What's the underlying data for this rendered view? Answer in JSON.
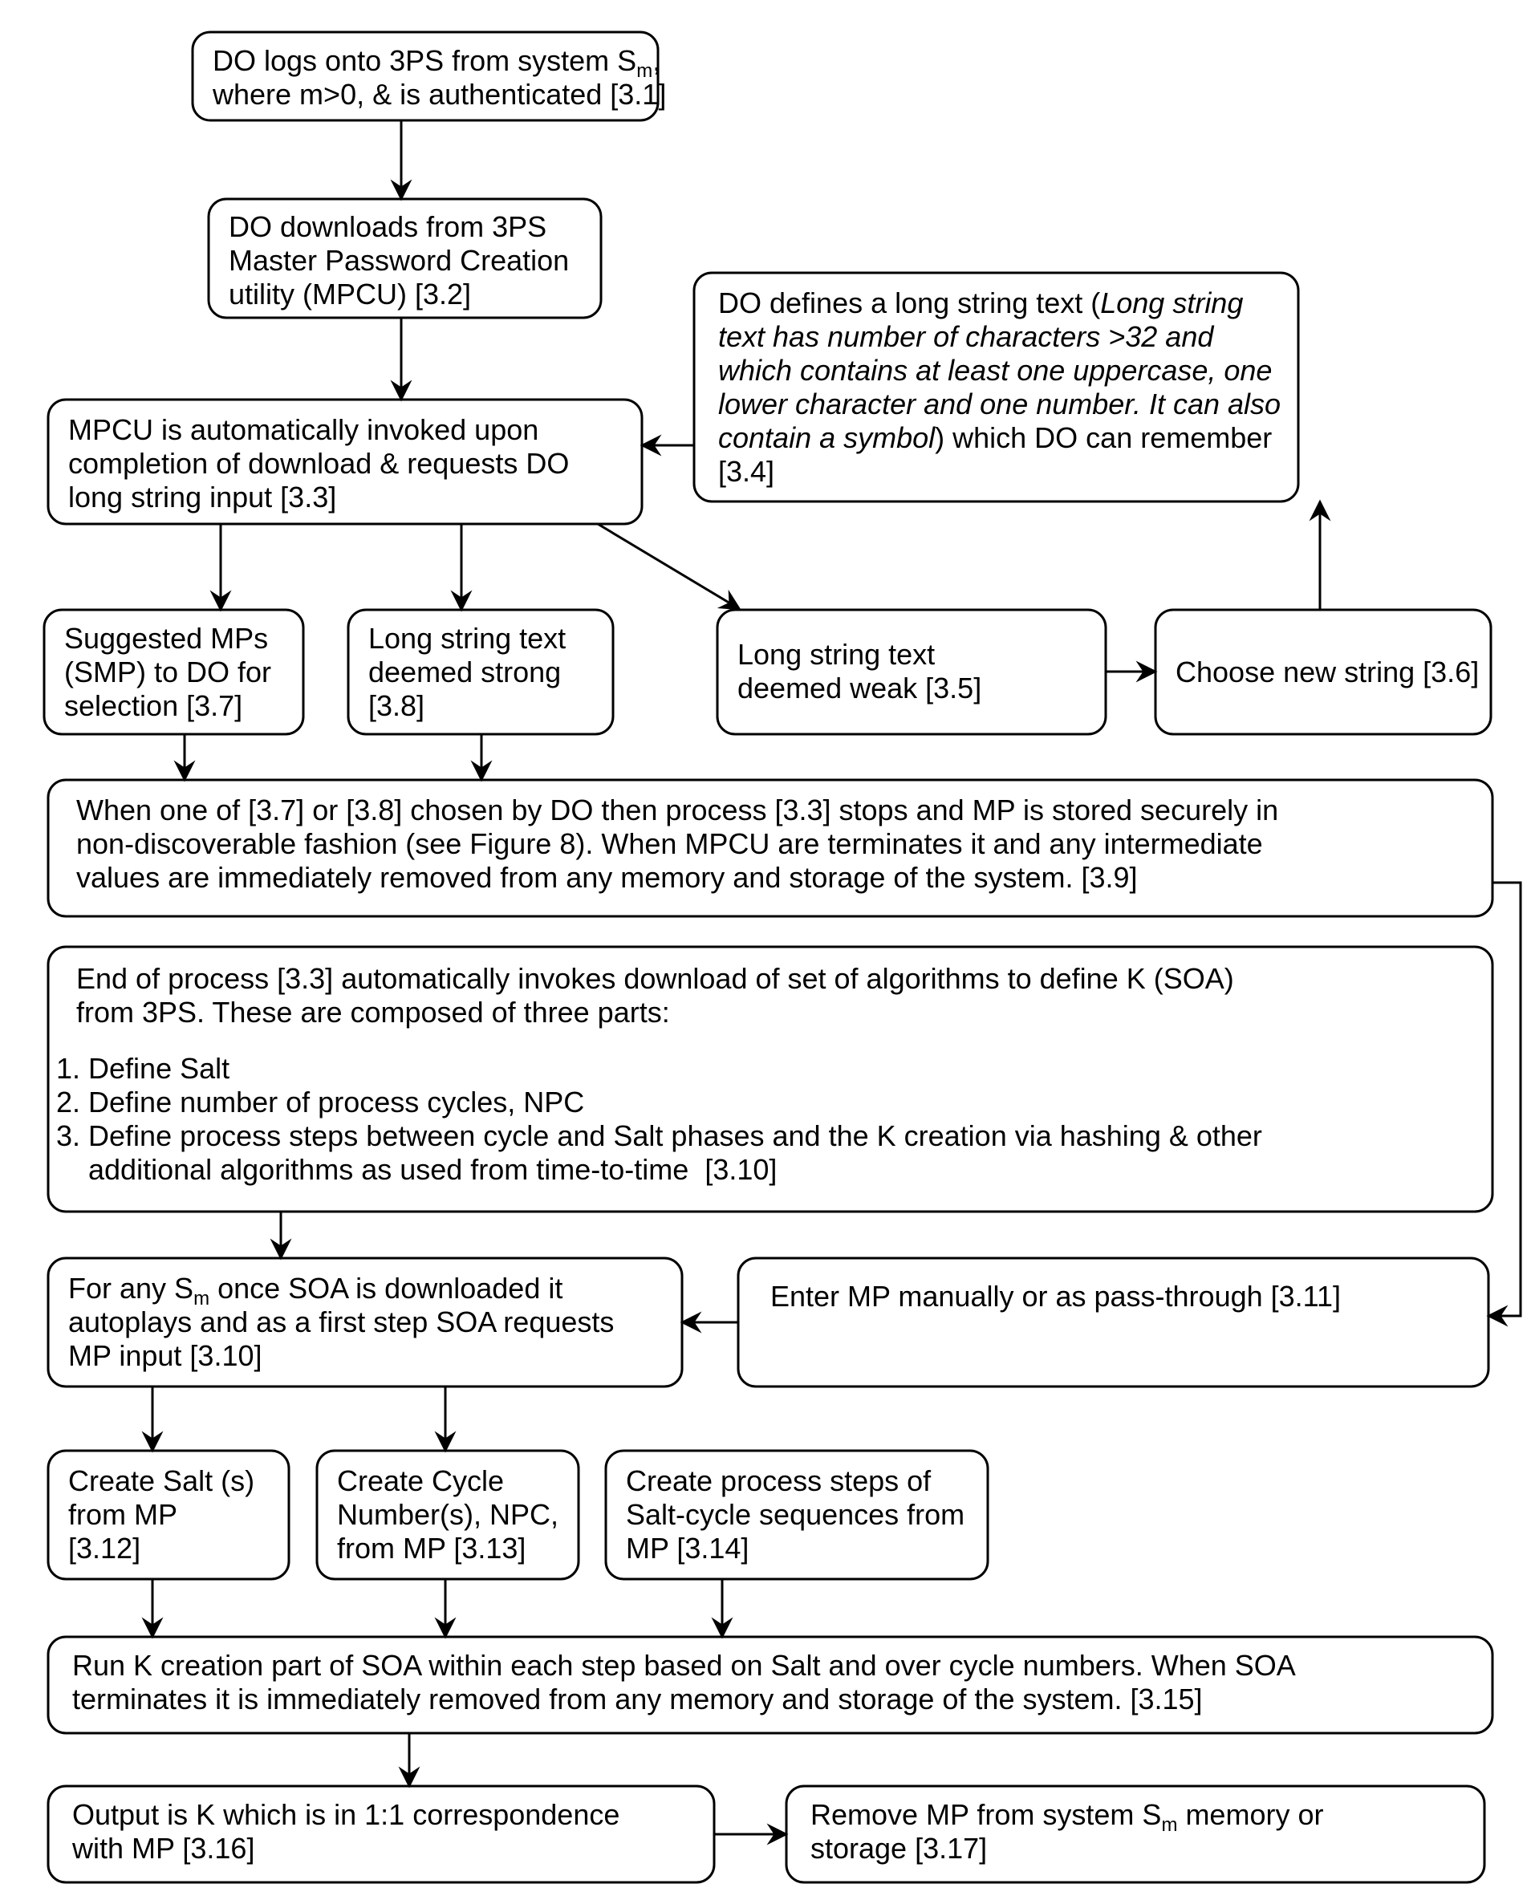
{
  "chart_data": {
    "type": "flowchart",
    "nodes": [
      {
        "id": "3.1",
        "lines": [
          "DO logs onto 3PS from system S_m,",
          "where m>0, & is authenticated [3.1]"
        ]
      },
      {
        "id": "3.2",
        "lines": [
          "DO downloads from 3PS",
          "Master Password Creation",
          "utility (MPCU) [3.2]"
        ]
      },
      {
        "id": "3.3",
        "lines": [
          "MPCU is automatically invoked upon",
          "completion of download & requests DO",
          "long string input [3.3]"
        ]
      },
      {
        "id": "3.4",
        "lines": [
          "DO defines a long string text (Long string",
          "text has number of characters >32 and",
          "which contains at least one uppercase, one",
          "lower character and one number. It can also",
          "contain a symbol) which DO can remember",
          "[3.4]"
        ]
      },
      {
        "id": "3.7",
        "lines": [
          "Suggested MPs",
          "(SMP) to DO for",
          "selection [3.7]"
        ]
      },
      {
        "id": "3.8",
        "lines": [
          "Long string text",
          "deemed strong",
          "[3.8]"
        ]
      },
      {
        "id": "3.5",
        "lines": [
          "Long string text",
          "deemed weak [3.5]"
        ]
      },
      {
        "id": "3.6",
        "lines": [
          "Choose new string [3.6]"
        ]
      },
      {
        "id": "3.9",
        "lines": [
          "When one of [3.7] or [3.8] chosen by DO then process [3.3] stops and MP is stored securely in",
          "non-discoverable fashion (see Figure 8). When MPCU are terminates it and any intermediate",
          "values are immediately removed from any memory and storage of the system. [3.9]"
        ]
      },
      {
        "id": "3.10a",
        "lines": [
          "End of process [3.3] automatically invokes download of set of algorithms to define K (SOA)",
          "from 3PS. These are composed of three parts:",
          "1. Define Salt",
          "2. Define number of process cycles, NPC",
          "3. Define process steps between cycle and Salt phases and the K creation via hashing & other",
          "    additional algorithms as used from time-to-time  [3.10]"
        ]
      },
      {
        "id": "3.10b",
        "lines": [
          "For any S_m once SOA is downloaded it",
          "autoplays and as a first step SOA requests",
          "MP input [3.10]"
        ]
      },
      {
        "id": "3.11",
        "lines": [
          "Enter MP manually or as pass-through [3.11]"
        ]
      },
      {
        "id": "3.12",
        "lines": [
          "Create Salt (s)",
          "from MP",
          "[3.12]"
        ]
      },
      {
        "id": "3.13",
        "lines": [
          "Create Cycle",
          "Number(s), NPC,",
          "from MP [3.13]"
        ]
      },
      {
        "id": "3.14",
        "lines": [
          "Create process steps of",
          "Salt-cycle sequences from",
          "MP [3.14]"
        ]
      },
      {
        "id": "3.15",
        "lines": [
          "Run K creation part of SOA within each step based on Salt and over cycle numbers. When SOA",
          "terminates it is immediately removed from any memory and storage of the system.  [3.15]"
        ]
      },
      {
        "id": "3.16",
        "lines": [
          "Output is K which is in 1:1 correspondence",
          "with MP [3.16]"
        ]
      },
      {
        "id": "3.17",
        "lines": [
          "Remove MP from system S_m memory or",
          "storage [3.17]"
        ]
      }
    ],
    "edges": [
      [
        "3.1",
        "3.2"
      ],
      [
        "3.2",
        "3.3"
      ],
      [
        "3.4",
        "3.3"
      ],
      [
        "3.3",
        "3.7"
      ],
      [
        "3.3",
        "3.8"
      ],
      [
        "3.3",
        "3.5"
      ],
      [
        "3.5",
        "3.6"
      ],
      [
        "3.6",
        "3.4"
      ],
      [
        "3.7",
        "3.9"
      ],
      [
        "3.8",
        "3.9"
      ],
      [
        "3.9",
        "3.11"
      ],
      [
        "3.10a",
        "3.10b"
      ],
      [
        "3.11",
        "3.10b"
      ],
      [
        "3.10b",
        "3.12"
      ],
      [
        "3.10b",
        "3.13"
      ],
      [
        "3.12",
        "3.15"
      ],
      [
        "3.13",
        "3.15"
      ],
      [
        "3.14",
        "3.15"
      ],
      [
        "3.15",
        "3.16"
      ],
      [
        "3.16",
        "3.17"
      ]
    ]
  },
  "n": {
    "b31": {
      "l1a": "DO logs onto 3PS from system S",
      "l1sub": "m",
      "l1b": ",",
      "l2": "where m>0, & is authenticated [3.1]"
    },
    "b32": {
      "l1": "DO downloads from 3PS",
      "l2": "Master Password Creation",
      "l3": "utility (MPCU) [3.2]"
    },
    "b33": {
      "l1": "MPCU is automatically invoked upon",
      "l2": "completion of download & requests DO",
      "l3": "long string input [3.3]"
    },
    "b34": {
      "l1a": "DO defines a long string text (",
      "l1b": "Long string",
      "l2": "text has number of characters >32 and",
      "l3": "which contains at least one uppercase, one",
      "l4": "lower character and one number. It can also",
      "l5": "contain a symbol",
      "l5b": ") which DO can remember",
      "l6": "[3.4]"
    },
    "b37": {
      "l1": "Suggested MPs",
      "l2": "(SMP) to DO for",
      "l3": "selection [3.7]"
    },
    "b38": {
      "l1": "Long string text",
      "l2": "deemed strong",
      "l3": "[3.8]"
    },
    "b35": {
      "l1": "Long string text",
      "l2": "deemed weak [3.5]"
    },
    "b36": {
      "l1": "Choose new string [3.6]"
    },
    "b39": {
      "l1": "When one of [3.7] or [3.8] chosen by DO then process [3.3] stops and MP is stored securely in",
      "l2": "non-discoverable fashion (see Figure 8). When MPCU are terminates it and any intermediate",
      "l3": "values are immediately removed from any memory and storage of the system. [3.9]"
    },
    "b310": {
      "l1": "End of process [3.3] automatically invokes download of set of algorithms to define K (SOA)",
      "l2": "from 3PS. These are composed of three parts:",
      "l3": "1. Define Salt",
      "l4": "2. Define number of process cycles, NPC",
      "l5": "3. Define process steps between cycle and Salt phases and the K creation via hashing & other",
      "l6": "    additional algorithms as used from time-to-time  [3.10]"
    },
    "b310b": {
      "l1a": "For any S",
      "l1sub": "m",
      "l1b": " once SOA is downloaded it",
      "l2": "autoplays and as a first step SOA requests",
      "l3": "MP input [3.10]"
    },
    "b311": {
      "l1": "Enter MP manually or as pass-through [3.11]"
    },
    "b312": {
      "l1": "Create Salt (s)",
      "l2": "from MP",
      "l3": "[3.12]"
    },
    "b313": {
      "l1": "Create Cycle",
      "l2": "Number(s), NPC,",
      "l3": "from MP [3.13]"
    },
    "b314": {
      "l1": "Create process steps of",
      "l2": "Salt-cycle sequences from",
      "l3": "MP [3.14]"
    },
    "b315": {
      "l1": "Run K creation part of SOA within each step based on Salt and over cycle numbers. When SOA",
      "l2": "terminates it is immediately removed from any memory and storage of the system.  [3.15]"
    },
    "b316": {
      "l1": "Output is K which is in 1:1 correspondence",
      "l2": "with MP [3.16]"
    },
    "b317": {
      "l1a": "Remove MP from system S",
      "l1sub": "m",
      "l1b": " memory or",
      "l2": "storage [3.17]"
    }
  }
}
